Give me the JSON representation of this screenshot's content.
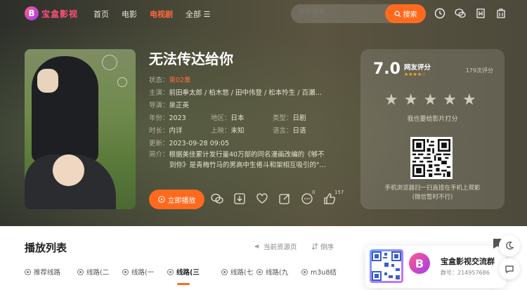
{
  "header": {
    "logo_text": "宝盒影视",
    "logo_badge": "B",
    "nav": [
      {
        "label": "首页"
      },
      {
        "label": "电影"
      },
      {
        "label": "电视剧",
        "active": true
      },
      {
        "label": "全部 ☰"
      }
    ],
    "search_placeholder": "搜索影片",
    "search_button": "搜索",
    "icons": [
      "clock-icon",
      "wechat-icon",
      "bookmark-icon",
      "building-icon"
    ]
  },
  "show": {
    "title": "无法传达给你",
    "status_key": "状态：",
    "status_value": "第02集",
    "cast_key": "主演：",
    "cast_value": "前田拳太郎 / 柏木悠 / 田中伟登 / 松本怜生 / 百瀬…",
    "director_key": "导演：",
    "director_value": "泉正英",
    "year_key": "年份：",
    "year_value": "2023",
    "region_key": "地区：",
    "region_value": "日本",
    "type_key": "类型：",
    "type_value": "日剧",
    "duration_key": "时长：",
    "duration_value": "内详",
    "release_key": "上映：",
    "release_value": "未知",
    "lang_key": "语言：",
    "lang_value": "日语",
    "updated_key": "更新：",
    "updated_value": "2023-09-28 09:05",
    "intro_key": "简介：",
    "intro_line1": "根据美佳累计发行量40万部的同名漫画改编的《够不",
    "intro_line2": "到你》是青梅竹马的男高中生倦斗和架相互吸引的\"…",
    "play_button": "立即播放",
    "comment_count": "0",
    "like_count": "157"
  },
  "rating": {
    "score": "7.0",
    "label": "网友评分",
    "stars_mini": "★★★★☆",
    "votes": "179次评分",
    "big_stars": [
      "★",
      "★",
      "★",
      "★",
      "★"
    ],
    "hint": "我也要给影片打分",
    "qr_hint_line1": "手机浏览器扫一扫直接在手机上观影",
    "qr_hint_line2": "(微信暂时不行)"
  },
  "playlist": {
    "title": "播放列表",
    "switch_source": "当前资源页",
    "order": "倒序",
    "tabs": [
      {
        "label": "推荐线路"
      },
      {
        "label": "线路(二"
      },
      {
        "label": "线路(一"
      },
      {
        "label": "线路(三",
        "active": true
      },
      {
        "label": "线路(七"
      },
      {
        "label": "线路(九"
      },
      {
        "label": "m3u8结"
      }
    ]
  },
  "group": {
    "name": "宝盒影视交流群",
    "number": "群号：214957686",
    "logo": "B"
  },
  "colors": {
    "accent": "#ff6a1f",
    "status": "#ff6a3d",
    "star": "#f2b21d"
  }
}
